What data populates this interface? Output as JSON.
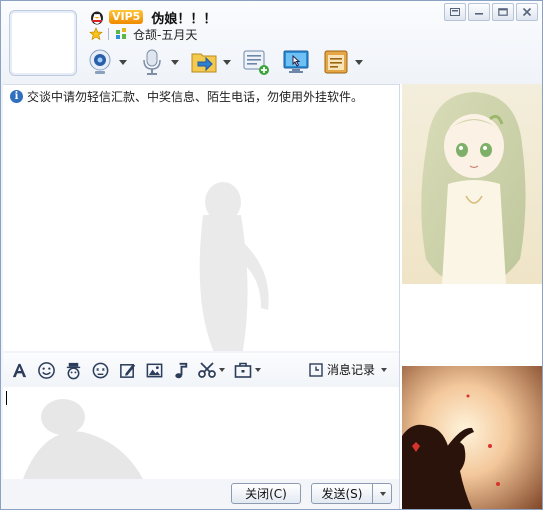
{
  "header": {
    "vip_badge": "VIP5",
    "nickname": "伪娘！！！",
    "signature": "仓颉-五月天"
  },
  "toolbar": {
    "icons": [
      "webcam-icon",
      "microphone-icon",
      "send-file-icon",
      "chat-add-icon",
      "remote-desktop-icon",
      "app-box-icon"
    ]
  },
  "chat": {
    "notice": "交谈中请勿轻信汇款、中奖信息、陌生电话，勿使用外挂软件。"
  },
  "format_bar": {
    "history_label": "消息记录"
  },
  "buttons": {
    "close_label": "关闭(C)",
    "send_label": "发送(S)"
  },
  "colors": {
    "accent": "#2f6fbe",
    "border": "#8aa3c4"
  }
}
